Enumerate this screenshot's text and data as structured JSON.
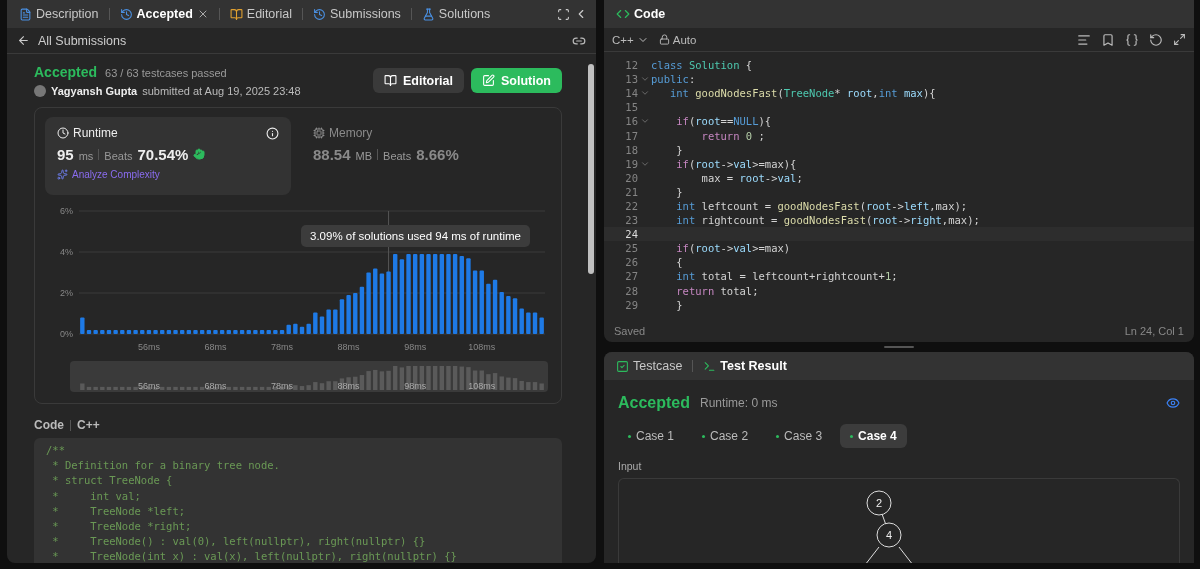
{
  "left_tabs": [
    {
      "label": "Description",
      "kind": "description",
      "selected": false,
      "closable": false
    },
    {
      "label": "Accepted",
      "kind": "history",
      "selected": true,
      "closable": true
    },
    {
      "label": "Editorial",
      "kind": "book",
      "selected": false,
      "closable": false
    },
    {
      "label": "Submissions",
      "kind": "history",
      "selected": false,
      "closable": false
    },
    {
      "label": "Solutions",
      "kind": "flask",
      "selected": false,
      "closable": false
    }
  ],
  "sub_header": {
    "back_label": "All Submissions"
  },
  "submission": {
    "status": "Accepted",
    "testcases": "63 / 63 testcases passed",
    "author": "Yagyansh Gupta",
    "submitted": "submitted at Aug 19, 2025 23:48",
    "buttons": [
      {
        "label": "Editorial",
        "kind": "secondary"
      },
      {
        "label": "Solution",
        "kind": "primary"
      }
    ]
  },
  "metrics": [
    {
      "title": "Runtime",
      "kind": "clock",
      "value": "95",
      "unit": "ms",
      "beats_label": "Beats",
      "beats": "70.54%",
      "analyze": "Analyze Complexity",
      "selected": true
    },
    {
      "title": "Memory",
      "kind": "chip",
      "value": "88.54",
      "unit": "MB",
      "beats_label": "Beats",
      "beats": "8.66%",
      "selected": false
    }
  ],
  "distribution": {
    "chart_data": {
      "type": "bar",
      "ylim": [
        0,
        6
      ],
      "yticks": [
        {
          "value": 0,
          "label": "0%"
        },
        {
          "value": 2,
          "label": "2%"
        },
        {
          "value": 4,
          "label": "4%"
        },
        {
          "value": 6,
          "label": "6%"
        }
      ],
      "categories": [
        null,
        null,
        null,
        null,
        null,
        null,
        null,
        null,
        null,
        null,
        "56ms",
        null,
        null,
        null,
        null,
        null,
        null,
        null,
        null,
        null,
        "68ms",
        null,
        null,
        null,
        null,
        null,
        null,
        null,
        null,
        null,
        "78ms",
        null,
        null,
        null,
        null,
        null,
        null,
        null,
        null,
        null,
        "88ms",
        null,
        null,
        null,
        null,
        null,
        null,
        null,
        null,
        null,
        "98ms",
        null,
        null,
        null,
        null,
        null,
        null,
        null,
        null,
        null,
        "108ms",
        null,
        null,
        null,
        null,
        null,
        null,
        null,
        null,
        null
      ],
      "values": [
        0.8,
        0.2,
        0.2,
        0.2,
        0.2,
        0.2,
        0.2,
        0.2,
        0.2,
        0.2,
        0.2,
        0.2,
        0.2,
        0.2,
        0.2,
        0.2,
        0.2,
        0.2,
        0.2,
        0.2,
        0.2,
        0.2,
        0.2,
        0.2,
        0.2,
        0.2,
        0.2,
        0.2,
        0.2,
        0.2,
        0.2,
        0.45,
        0.5,
        0.35,
        0.5,
        1.05,
        0.85,
        1.2,
        1.2,
        1.7,
        1.9,
        2.0,
        2.3,
        3.0,
        3.2,
        2.95,
        3.05,
        3.9,
        3.65,
        3.9,
        3.9,
        3.9,
        3.9,
        3.9,
        3.9,
        3.9,
        3.9,
        3.8,
        3.7,
        3.1,
        3.1,
        2.45,
        2.65,
        2.05,
        1.85,
        1.75,
        1.25,
        1.05,
        1.05,
        0.8
      ]
    },
    "tooltip": "3.09% of solutions used 94 ms of runtime",
    "navigator_labels": [
      "56ms",
      "68ms",
      "78ms",
      "88ms",
      "98ms",
      "108ms"
    ]
  },
  "code_section": {
    "title": "Code",
    "language": "C++",
    "lines": [
      "/**",
      " * Definition for a binary tree node.",
      " * struct TreeNode {",
      " *     int val;",
      " *     TreeNode *left;",
      " *     TreeNode *right;",
      " *     TreeNode() : val(0), left(nullptr), right(nullptr) {}",
      " *     TreeNode(int x) : val(x), left(nullptr), right(nullptr) {}"
    ]
  },
  "editor": {
    "title": "Code",
    "language": "C++",
    "mode": "Auto",
    "status": "Saved",
    "cursor": "Ln 24, Col 1",
    "lines": [
      {
        "number": "12",
        "fold": false,
        "current": false,
        "tokens": [
          {
            "text": "class ",
            "kind": "kw"
          },
          {
            "text": "Solution",
            "kind": "type"
          },
          {
            "text": " {",
            "kind": "p"
          }
        ]
      },
      {
        "number": "13",
        "fold": true,
        "current": false,
        "tokens": [
          {
            "text": "public",
            "kind": "kw"
          },
          {
            "text": ":",
            "kind": "p"
          }
        ]
      },
      {
        "number": "14",
        "fold": true,
        "current": false,
        "tokens": [
          {
            "text": "   int ",
            "kind": "kw"
          },
          {
            "text": "goodNodesFast",
            "kind": "fn"
          },
          {
            "text": "(",
            "kind": "p"
          },
          {
            "text": "TreeNode",
            "kind": "type"
          },
          {
            "text": "* ",
            "kind": "p"
          },
          {
            "text": "root",
            "kind": "var"
          },
          {
            "text": ",",
            "kind": "p"
          },
          {
            "text": "int ",
            "kind": "kw"
          },
          {
            "text": "max",
            "kind": "var"
          },
          {
            "text": "){",
            "kind": "p"
          }
        ]
      },
      {
        "number": "15",
        "fold": false,
        "current": false
      },
      {
        "number": "16",
        "fold": true,
        "current": false,
        "tokens": [
          {
            "text": "    if",
            "kind": "ctrl"
          },
          {
            "text": "(",
            "kind": "p"
          },
          {
            "text": "root",
            "kind": "var"
          },
          {
            "text": "==",
            "kind": "p"
          },
          {
            "text": "NULL",
            "kind": "kw"
          },
          {
            "text": "){",
            "kind": "p"
          }
        ]
      },
      {
        "number": "17",
        "fold": false,
        "current": false,
        "tokens": [
          {
            "text": "        return ",
            "kind": "ctrl"
          },
          {
            "text": "0",
            "kind": "num"
          },
          {
            "text": " ;",
            "kind": "p"
          }
        ]
      },
      {
        "number": "18",
        "fold": false,
        "current": false,
        "tokens": [
          {
            "text": "    }",
            "kind": "p"
          }
        ]
      },
      {
        "number": "19",
        "fold": true,
        "current": false,
        "tokens": [
          {
            "text": "    if",
            "kind": "ctrl"
          },
          {
            "text": "(",
            "kind": "p"
          },
          {
            "text": "root",
            "kind": "var"
          },
          {
            "text": "->",
            "kind": "p"
          },
          {
            "text": "val",
            "kind": "var"
          },
          {
            "text": ">=max){",
            "kind": "p"
          }
        ]
      },
      {
        "number": "20",
        "fold": false,
        "current": false,
        "tokens": [
          {
            "text": "        max = ",
            "kind": "p"
          },
          {
            "text": "root",
            "kind": "var"
          },
          {
            "text": "->",
            "kind": "p"
          },
          {
            "text": "val",
            "kind": "var"
          },
          {
            "text": ";",
            "kind": "p"
          }
        ]
      },
      {
        "number": "21",
        "fold": false,
        "current": false,
        "tokens": [
          {
            "text": "    }",
            "kind": "p"
          }
        ]
      },
      {
        "number": "22",
        "fold": false,
        "current": false,
        "tokens": [
          {
            "text": "    int",
            "kind": "kw"
          },
          {
            "text": " leftcount = ",
            "kind": "p"
          },
          {
            "text": "goodNodesFast",
            "kind": "fn"
          },
          {
            "text": "(",
            "kind": "p"
          },
          {
            "text": "root",
            "kind": "var"
          },
          {
            "text": "->",
            "kind": "p"
          },
          {
            "text": "left",
            "kind": "var"
          },
          {
            "text": ",max);",
            "kind": "p"
          }
        ]
      },
      {
        "number": "23",
        "fold": false,
        "current": false,
        "tokens": [
          {
            "text": "    int",
            "kind": "kw"
          },
          {
            "text": " rightcount = ",
            "kind": "p"
          },
          {
            "text": "goodNodesFast",
            "kind": "fn"
          },
          {
            "text": "(",
            "kind": "p"
          },
          {
            "text": "root",
            "kind": "var"
          },
          {
            "text": "->",
            "kind": "p"
          },
          {
            "text": "right",
            "kind": "var"
          },
          {
            "text": ",max);",
            "kind": "p"
          }
        ]
      },
      {
        "number": "24",
        "fold": false,
        "current": true
      },
      {
        "number": "25",
        "fold": false,
        "current": false,
        "tokens": [
          {
            "text": "    if",
            "kind": "ctrl"
          },
          {
            "text": "(",
            "kind": "p"
          },
          {
            "text": "root",
            "kind": "var"
          },
          {
            "text": "->",
            "kind": "p"
          },
          {
            "text": "val",
            "kind": "var"
          },
          {
            "text": ">=max)",
            "kind": "p"
          }
        ]
      },
      {
        "number": "26",
        "fold": false,
        "current": false,
        "tokens": [
          {
            "text": "    {",
            "kind": "p"
          }
        ]
      },
      {
        "number": "27",
        "fold": false,
        "current": false,
        "tokens": [
          {
            "text": "    int",
            "kind": "kw"
          },
          {
            "text": " total = leftcount+rightcount+",
            "kind": "p"
          },
          {
            "text": "1",
            "kind": "num"
          },
          {
            "text": ";",
            "kind": "p"
          }
        ]
      },
      {
        "number": "28",
        "fold": false,
        "current": false,
        "tokens": [
          {
            "text": "    return",
            "kind": "ctrl"
          },
          {
            "text": " total;",
            "kind": "p"
          }
        ]
      },
      {
        "number": "29",
        "fold": false,
        "current": false,
        "tokens": [
          {
            "text": "    }",
            "kind": "p"
          }
        ]
      }
    ]
  },
  "console": {
    "tabs": [
      {
        "label": "Testcase",
        "kind": "check",
        "selected": false
      },
      {
        "label": "Test Result",
        "kind": "terminal",
        "selected": true
      }
    ],
    "status": "Accepted",
    "runtime": "Runtime: 0 ms",
    "cases": [
      {
        "label": "Case 1",
        "selected": false
      },
      {
        "label": "Case 2",
        "selected": false
      },
      {
        "label": "Case 3",
        "selected": false
      },
      {
        "label": "Case 4",
        "selected": true
      }
    ],
    "input_label": "Input",
    "tree_nodes": [
      "2",
      "4"
    ]
  }
}
